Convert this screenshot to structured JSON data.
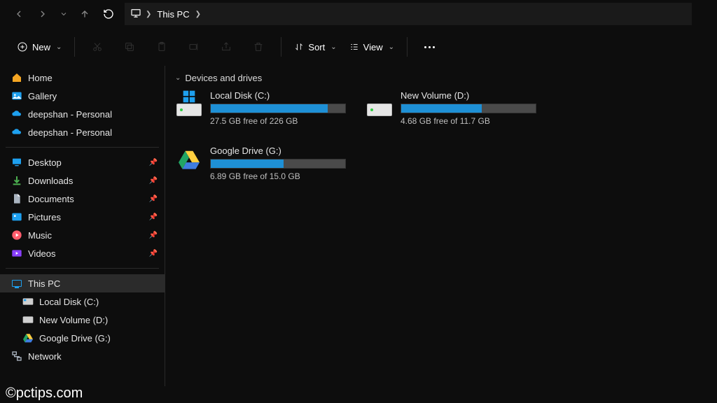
{
  "nav": {
    "location_root": "This PC"
  },
  "commandbar": {
    "new": "New",
    "sort": "Sort",
    "view": "View"
  },
  "sidebar": {
    "group1": [
      {
        "label": "Home"
      },
      {
        "label": "Gallery"
      },
      {
        "label": "deepshan - Personal"
      },
      {
        "label": "deepshan - Personal"
      }
    ],
    "group2": [
      {
        "label": "Desktop"
      },
      {
        "label": "Downloads"
      },
      {
        "label": "Documents"
      },
      {
        "label": "Pictures"
      },
      {
        "label": "Music"
      },
      {
        "label": "Videos"
      }
    ],
    "group3": [
      {
        "label": "This PC",
        "selected": true
      },
      {
        "label": "Local Disk (C:)",
        "indent": true
      },
      {
        "label": "New Volume (D:)",
        "indent": true
      },
      {
        "label": "Google Drive (G:)",
        "indent": true
      },
      {
        "label": "Network"
      }
    ]
  },
  "section_title": "Devices and drives",
  "drives": [
    {
      "name": "Local Disk (C:)",
      "free": "27.5 GB free of 226 GB",
      "used_pct": 87
    },
    {
      "name": "New Volume (D:)",
      "free": "4.68 GB free of 11.7 GB",
      "used_pct": 60
    },
    {
      "name": "Google Drive (G:)",
      "free": "6.89 GB free of 15.0 GB",
      "used_pct": 54
    }
  ],
  "watermark": "©pctips.com"
}
